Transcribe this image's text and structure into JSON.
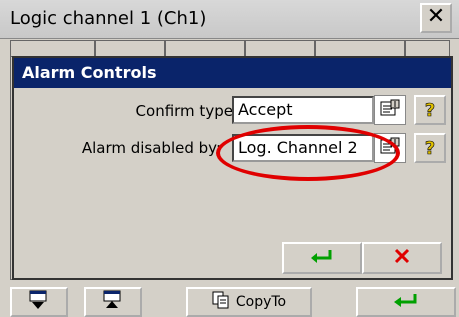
{
  "window": {
    "title": "Logic channel 1 (Ch1)",
    "close_label": "✕"
  },
  "dialog": {
    "title": "Alarm Controls",
    "fields": [
      {
        "label": "Confirm type:",
        "value": "Accept"
      },
      {
        "label": "Alarm disabled by:",
        "value": "Log. Channel 2"
      }
    ]
  },
  "bottom_bar": {
    "copy_label": "CopyTo"
  },
  "icons": {
    "properties": "properties-icon",
    "help": "help-icon",
    "ok": "enter-icon",
    "cancel": "cancel-x-icon",
    "nav_down": "nav-down-icon",
    "nav_up": "nav-up-icon",
    "copy": "copy-icon"
  },
  "colors": {
    "dialog_title_bg": "#0a246a",
    "ok_green": "#00a000",
    "cancel_red": "#e00000",
    "annotation_red": "#e00000"
  }
}
